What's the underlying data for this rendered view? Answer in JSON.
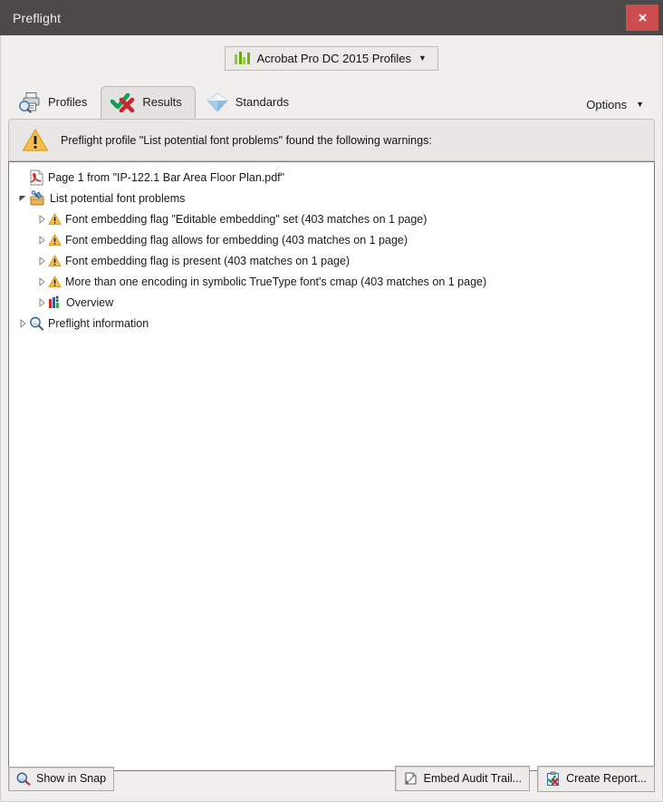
{
  "window": {
    "title": "Preflight",
    "close_label": "x"
  },
  "profile_selector": {
    "label": "Acrobat Pro DC 2015 Profiles",
    "caret": "▼",
    "icon": "bar-chart-icon"
  },
  "tabs": [
    {
      "label": "Profiles",
      "icon": "printer-search-icon",
      "active": false
    },
    {
      "label": "Results",
      "icon": "check-cross-icon",
      "active": true
    },
    {
      "label": "Standards",
      "icon": "diamond-icon",
      "active": false
    }
  ],
  "options": {
    "label": "Options",
    "caret": "▼"
  },
  "banner": {
    "icon": "warning-triangle-icon",
    "text": "Preflight profile \"List potential font problems\" found the following warnings:"
  },
  "tree": [
    {
      "label": "Page 1 from \"IP-122.1 Bar Area Floor Plan.pdf\"",
      "icon": "pdf-file-icon",
      "indent": 0,
      "disclosure": "none"
    },
    {
      "label": "List potential font problems",
      "icon": "profile-wrench-icon",
      "indent": 0,
      "disclosure": "expanded"
    },
    {
      "label": "Font embedding flag \"Editable embedding\" set (403 matches on 1 page)",
      "icon": "warning-triangle-icon",
      "indent": 1,
      "disclosure": "collapsed"
    },
    {
      "label": "Font embedding flag allows for embedding (403 matches on 1 page)",
      "icon": "warning-triangle-icon",
      "indent": 1,
      "disclosure": "collapsed"
    },
    {
      "label": "Font embedding flag is present (403 matches on 1 page)",
      "icon": "warning-triangle-icon",
      "indent": 1,
      "disclosure": "collapsed"
    },
    {
      "label": "More than one encoding in symbolic TrueType font's cmap (403 matches on 1 page)",
      "icon": "warning-triangle-icon",
      "indent": 1,
      "disclosure": "collapsed"
    },
    {
      "label": "Overview",
      "icon": "overview-chart-icon",
      "indent": 1,
      "disclosure": "collapsed"
    },
    {
      "label": "Preflight information",
      "icon": "magnifier-icon",
      "indent": 0,
      "disclosure": "collapsed"
    }
  ],
  "footer": {
    "show_in_snap": "Show in Snap",
    "embed_audit_trail": "Embed Audit Trail...",
    "create_report": "Create Report..."
  },
  "colors": {
    "titlebar": "#4c4a48",
    "close_button": "#cb4d4d",
    "dialog_background": "#f0efee",
    "panel_background": "#ffffff",
    "banner_background": "#e9e7e5",
    "warning_orange": "#f5b942",
    "check_green": "#139e57",
    "cross_red": "#c8282d",
    "profile_bars_green": "#7cb518"
  }
}
